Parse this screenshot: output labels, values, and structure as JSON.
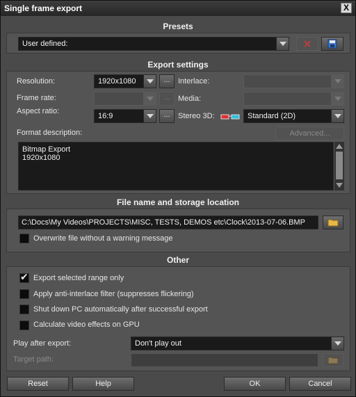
{
  "window": {
    "title": "Single frame export",
    "close_label": "X"
  },
  "presets": {
    "heading": "Presets",
    "selected": "User defined:"
  },
  "export_settings": {
    "heading": "Export settings",
    "resolution_label": "Resolution:",
    "resolution_value": "1920x1080",
    "framerate_label": "Frame rate:",
    "framerate_value": "",
    "aspect_label": "Aspect ratio:",
    "aspect_value": "16:9",
    "interlace_label": "Interlace:",
    "interlace_value": "",
    "media_label": "Media:",
    "media_value": "",
    "stereo_label": "Stereo 3D:",
    "stereo_value": "Standard (2D)",
    "ellipsis": "...",
    "format_desc_label": "Format description:",
    "advanced_label": "Advanced...",
    "desc_line1": "Bitmap Export",
    "desc_line2": "1920x1080"
  },
  "file": {
    "heading": "File name and storage location",
    "path": "C:\\Docs\\My Videos\\PROJECTS\\MISC, TESTS, DEMOS etc\\Clock\\2013-07-06.BMP",
    "overwrite_label": "Overwrite file without a warning message",
    "overwrite_checked": false
  },
  "other": {
    "heading": "Other",
    "options": [
      {
        "label": "Export selected range only",
        "checked": true
      },
      {
        "label": "Apply anti-interlace filter (suppresses flickering)",
        "checked": false
      },
      {
        "label": "Shut down PC automatically after successful export",
        "checked": false
      },
      {
        "label": "Calculate video effects on GPU",
        "checked": false
      }
    ],
    "play_after_label": "Play after export:",
    "play_after_value": "Don't play out",
    "target_path_label": "Target path:",
    "target_path_value": ""
  },
  "buttons": {
    "reset": "Reset",
    "help": "Help",
    "ok": "OK",
    "cancel": "Cancel"
  },
  "colors": {
    "delete_icon": "#d03030",
    "save_icon": "#3a78c8",
    "folder_icon": "#e8b848",
    "anaglyph_red": "#e03030",
    "anaglyph_cyan": "#30c0e0"
  },
  "icons": {
    "delete": "delete-preset-icon",
    "save": "save-preset-icon",
    "folder": "folder-icon",
    "stereo": "anaglyph-glasses-icon"
  }
}
